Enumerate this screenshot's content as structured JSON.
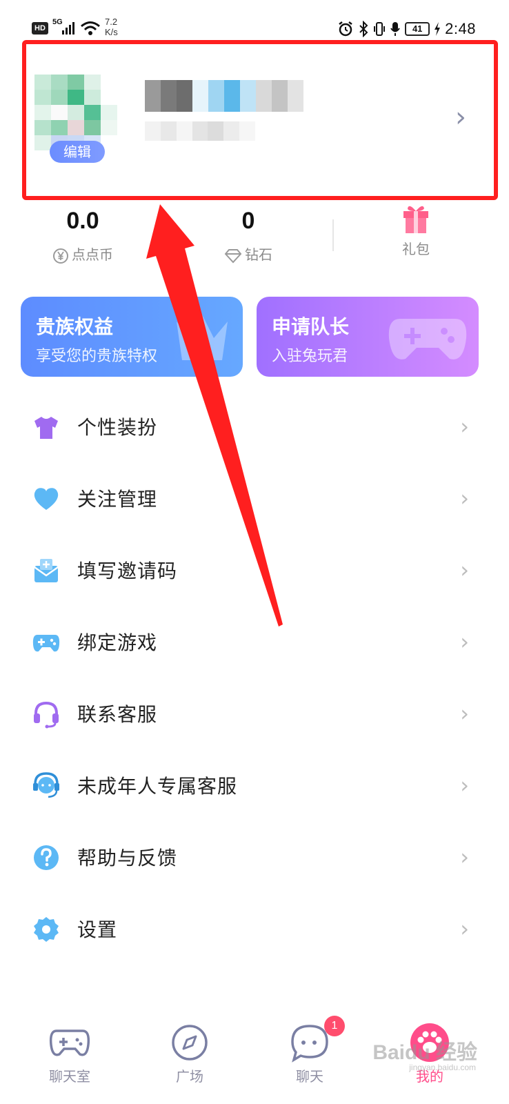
{
  "status_bar": {
    "hd": "HD",
    "network": "5G",
    "speed": "7.2 K/s",
    "battery": "41",
    "time": "2:48"
  },
  "profile": {
    "edit_label": "编辑",
    "chevron": "›"
  },
  "stats": {
    "coins": {
      "value": "0.0",
      "label": "点点币"
    },
    "diamonds": {
      "value": "0",
      "label": "钻石"
    },
    "gift": {
      "label": "礼包"
    }
  },
  "banners": {
    "vip": {
      "title": "贵族权益",
      "subtitle": "享受您的贵族特权"
    },
    "captain": {
      "title": "申请队长",
      "subtitle": "入驻兔玩君"
    }
  },
  "menu": [
    {
      "label": "个性装扮",
      "icon": "shirt-icon"
    },
    {
      "label": "关注管理",
      "icon": "heart-icon"
    },
    {
      "label": "填写邀请码",
      "icon": "invite-mail-icon"
    },
    {
      "label": "绑定游戏",
      "icon": "gamepad-icon"
    },
    {
      "label": "联系客服",
      "icon": "headset-icon"
    },
    {
      "label": "未成年人专属客服",
      "icon": "service-agent-icon"
    },
    {
      "label": "帮助与反馈",
      "icon": "help-icon"
    },
    {
      "label": "设置",
      "icon": "settings-icon"
    }
  ],
  "menu_chevron": "›",
  "tabs": [
    {
      "label": "聊天室",
      "icon": "gamepad-tab-icon"
    },
    {
      "label": "广场",
      "icon": "compass-icon"
    },
    {
      "label": "聊天",
      "icon": "chat-icon",
      "badge": "1"
    },
    {
      "label": "我的",
      "icon": "paw-icon",
      "active": true
    }
  ],
  "watermark": {
    "main": "Baidu 经验",
    "sub": "jingyan.baidu.com"
  },
  "colors": {
    "accent_blue": "#6b8dff",
    "accent_purple": "#a070ff",
    "annotation_red": "#ff1f1f",
    "active_tab": "#ff4d8a"
  }
}
